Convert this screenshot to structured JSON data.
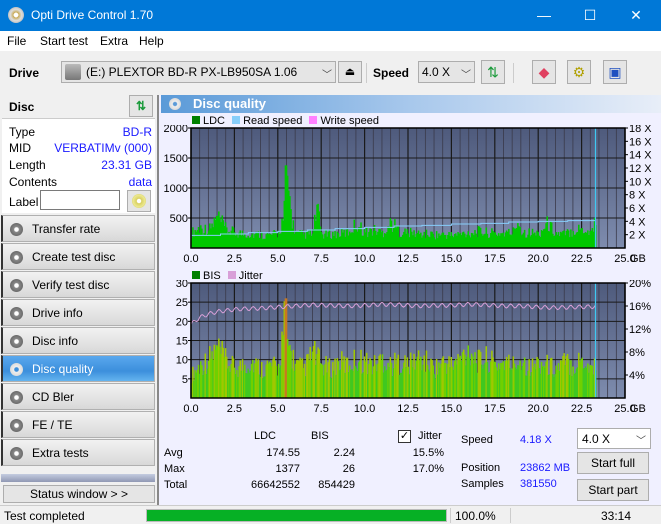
{
  "window": {
    "title": "Opti Drive Control 1.70",
    "controls": {
      "minimize": "—",
      "maximize": "☐",
      "close": "✕"
    }
  },
  "menu": [
    "File",
    "Start test",
    "Extra",
    "Help"
  ],
  "toolbar": {
    "drive_label": "Drive",
    "drive_value": "(E:)  PLEXTOR BD-R  PX-LB950SA 1.06",
    "speed_label": "Speed",
    "speed_value": "4.0 X",
    "icons": [
      "eject-icon",
      "refresh-icon",
      "erase-icon",
      "settings-icon",
      "save-icon"
    ]
  },
  "disc": {
    "title": "Disc",
    "rows": [
      {
        "key": "Type",
        "value": "BD-R"
      },
      {
        "key": "MID",
        "value": "VERBATIMv (000)"
      },
      {
        "key": "Length",
        "value": "23.31 GB"
      },
      {
        "key": "Contents",
        "value": "data"
      }
    ],
    "label_key": "Label",
    "label_value": ""
  },
  "nav": [
    {
      "label": "Transfer rate",
      "active": false
    },
    {
      "label": "Create test disc",
      "active": false
    },
    {
      "label": "Verify test disc",
      "active": false
    },
    {
      "label": "Drive info",
      "active": false
    },
    {
      "label": "Disc info",
      "active": false
    },
    {
      "label": "Disc quality",
      "active": true
    },
    {
      "label": "CD Bler",
      "active": false
    },
    {
      "label": "FE / TE",
      "active": false
    },
    {
      "label": "Extra tests",
      "active": false
    }
  ],
  "status_window_label": "Status window > >",
  "panel": {
    "title": "Disc quality"
  },
  "chart_data": [
    {
      "type": "bar",
      "title": "LDC",
      "legend": [
        {
          "name": "LDC",
          "color": "#008000"
        },
        {
          "name": "Read speed",
          "color": "#87cefa"
        },
        {
          "name": "Write speed",
          "color": "#ff80ff"
        }
      ],
      "legend_placement": "top-left",
      "xlabel": "GB",
      "xlim": [
        0,
        25
      ],
      "x_ticks": [
        "0.0",
        "2.5",
        "5.0",
        "7.5",
        "10.0",
        "12.5",
        "15.0",
        "17.5",
        "20.0",
        "22.5",
        "25.0"
      ],
      "ylim": [
        0,
        2000
      ],
      "y_ticks": [
        "500",
        "1000",
        "1500",
        "2000"
      ],
      "y2lim": [
        0,
        18
      ],
      "y2_ticks": [
        "2 X",
        "4 X",
        "6 X",
        "8 X",
        "10 X",
        "12 X",
        "14 X",
        "16 X",
        "18 X"
      ],
      "grid": true,
      "series": [
        {
          "name": "LDC",
          "x": [
            0.0,
            0.5,
            1.0,
            1.5,
            2.0,
            2.5,
            3.0,
            3.5,
            4.0,
            4.5,
            5.0,
            5.3,
            5.5,
            5.8,
            6.0,
            6.5,
            7.0,
            7.2,
            7.5,
            8.0,
            8.5,
            9.0,
            9.5,
            10.0,
            10.5,
            11.0,
            11.5,
            12.0,
            12.5,
            13.0,
            13.5,
            14.0,
            14.5,
            15.0,
            15.5,
            16.0,
            16.5,
            17.0,
            17.5,
            18.0,
            18.5,
            18.8,
            19.0,
            19.5,
            20.0,
            20.5,
            21.0,
            21.5,
            22.0,
            22.5,
            23.0,
            23.3
          ],
          "values": [
            300,
            400,
            350,
            600,
            350,
            300,
            280,
            270,
            260,
            250,
            280,
            600,
            1377,
            500,
            280,
            260,
            270,
            800,
            260,
            270,
            280,
            300,
            480,
            300,
            350,
            300,
            500,
            310,
            300,
            280,
            270,
            260,
            260,
            250,
            270,
            300,
            320,
            300,
            280,
            290,
            300,
            550,
            320,
            300,
            280,
            480,
            280,
            270,
            350,
            380,
            300,
            600
          ]
        },
        {
          "name": "Read speed",
          "x": [
            0.0,
            1.7,
            3.3,
            5.0,
            6.7,
            8.3,
            10.0,
            11.7,
            13.3,
            15.0,
            16.7,
            18.3,
            20.0,
            21.7,
            23.3
          ],
          "values": [
            1.9,
            2.1,
            2.3,
            2.5,
            2.7,
            2.9,
            3.1,
            3.3,
            3.4,
            3.6,
            3.7,
            3.9,
            4.0,
            4.1,
            4.2
          ]
        }
      ],
      "marker_x": 23.3
    },
    {
      "type": "bar",
      "title": "BIS",
      "legend": [
        {
          "name": "BIS",
          "color": "#008000"
        },
        {
          "name": "Jitter",
          "color": "#d8a0d8"
        }
      ],
      "legend_placement": "top-left",
      "xlabel": "GB",
      "xlim": [
        0,
        25
      ],
      "x_ticks": [
        "0.0",
        "2.5",
        "5.0",
        "7.5",
        "10.0",
        "12.5",
        "15.0",
        "17.5",
        "20.0",
        "22.5",
        "25.0"
      ],
      "ylim": [
        0,
        30
      ],
      "y_ticks": [
        "5",
        "10",
        "15",
        "20",
        "25",
        "30"
      ],
      "y2lim": [
        0,
        20
      ],
      "y2_ticks": [
        "4%",
        "8%",
        "12%",
        "16%",
        "20%"
      ],
      "grid": true,
      "series": [
        {
          "name": "BIS",
          "x": [
            0.0,
            0.5,
            1.0,
            1.5,
            2.0,
            2.5,
            3.0,
            3.5,
            4.0,
            4.5,
            5.0,
            5.4,
            5.5,
            6.0,
            6.5,
            7.0,
            7.5,
            8.0,
            8.5,
            9.0,
            9.5,
            10.0,
            10.5,
            11.0,
            11.5,
            12.0,
            12.5,
            13.0,
            13.5,
            14.0,
            14.5,
            15.0,
            15.5,
            16.0,
            16.5,
            17.0,
            17.5,
            18.0,
            18.5,
            19.0,
            19.5,
            20.0,
            20.5,
            21.0,
            21.5,
            22.0,
            22.5,
            23.0,
            23.3
          ],
          "values": [
            7,
            10,
            12,
            15,
            11,
            9,
            10,
            11,
            9,
            10,
            9,
            26,
            17,
            10,
            9,
            14,
            10,
            9,
            11,
            10,
            12,
            11,
            10,
            12,
            10,
            11,
            10,
            12,
            11,
            9,
            11,
            10,
            12,
            15,
            11,
            12,
            10,
            11,
            10,
            12,
            9,
            11,
            10,
            9,
            11,
            10,
            12,
            9,
            11
          ]
        },
        {
          "name": "Jitter",
          "unit": "%",
          "x": [
            0.0,
            0.5,
            1.0,
            1.5,
            2.0,
            2.5,
            3.0,
            4.0,
            5.0,
            6.0,
            7.0,
            8.0,
            9.0,
            10.0,
            11.0,
            12.0,
            13.0,
            14.0,
            15.0,
            16.0,
            17.0,
            18.0,
            19.0,
            20.0,
            21.0,
            22.0,
            23.3
          ],
          "values": [
            12.8,
            14.0,
            14.6,
            15.0,
            15.2,
            15.4,
            15.5,
            15.6,
            15.8,
            16.0,
            16.2,
            16.1,
            16.0,
            16.1,
            16.3,
            16.2,
            16.0,
            16.1,
            16.1,
            16.3,
            16.2,
            16.0,
            16.0,
            15.8,
            15.7,
            15.8,
            15.9
          ]
        }
      ],
      "marker_x": 23.3
    }
  ],
  "stats": {
    "headers": [
      "LDC",
      "BIS"
    ],
    "rows": [
      {
        "label": "Avg",
        "ldc": "174.55",
        "bis": "2.24",
        "jitter": "15.5%"
      },
      {
        "label": "Max",
        "ldc": "1377",
        "bis": "26",
        "jitter": "17.0%"
      },
      {
        "label": "Total",
        "ldc": "66642552",
        "bis": "854429",
        "jitter": ""
      }
    ],
    "jitter_label": "Jitter",
    "jitter_checked": true
  },
  "run": {
    "speed_label": "Speed",
    "speed_value": "4.18 X",
    "position_label": "Position",
    "position_value": "23862 MB",
    "samples_label": "Samples",
    "samples_value": "381550",
    "speed_select": "4.0 X",
    "start_full": "Start full",
    "start_part": "Start part"
  },
  "statusbar": {
    "text": "Test completed",
    "progress": 100.0,
    "progress_label": "100.0%",
    "time": "33:14"
  }
}
